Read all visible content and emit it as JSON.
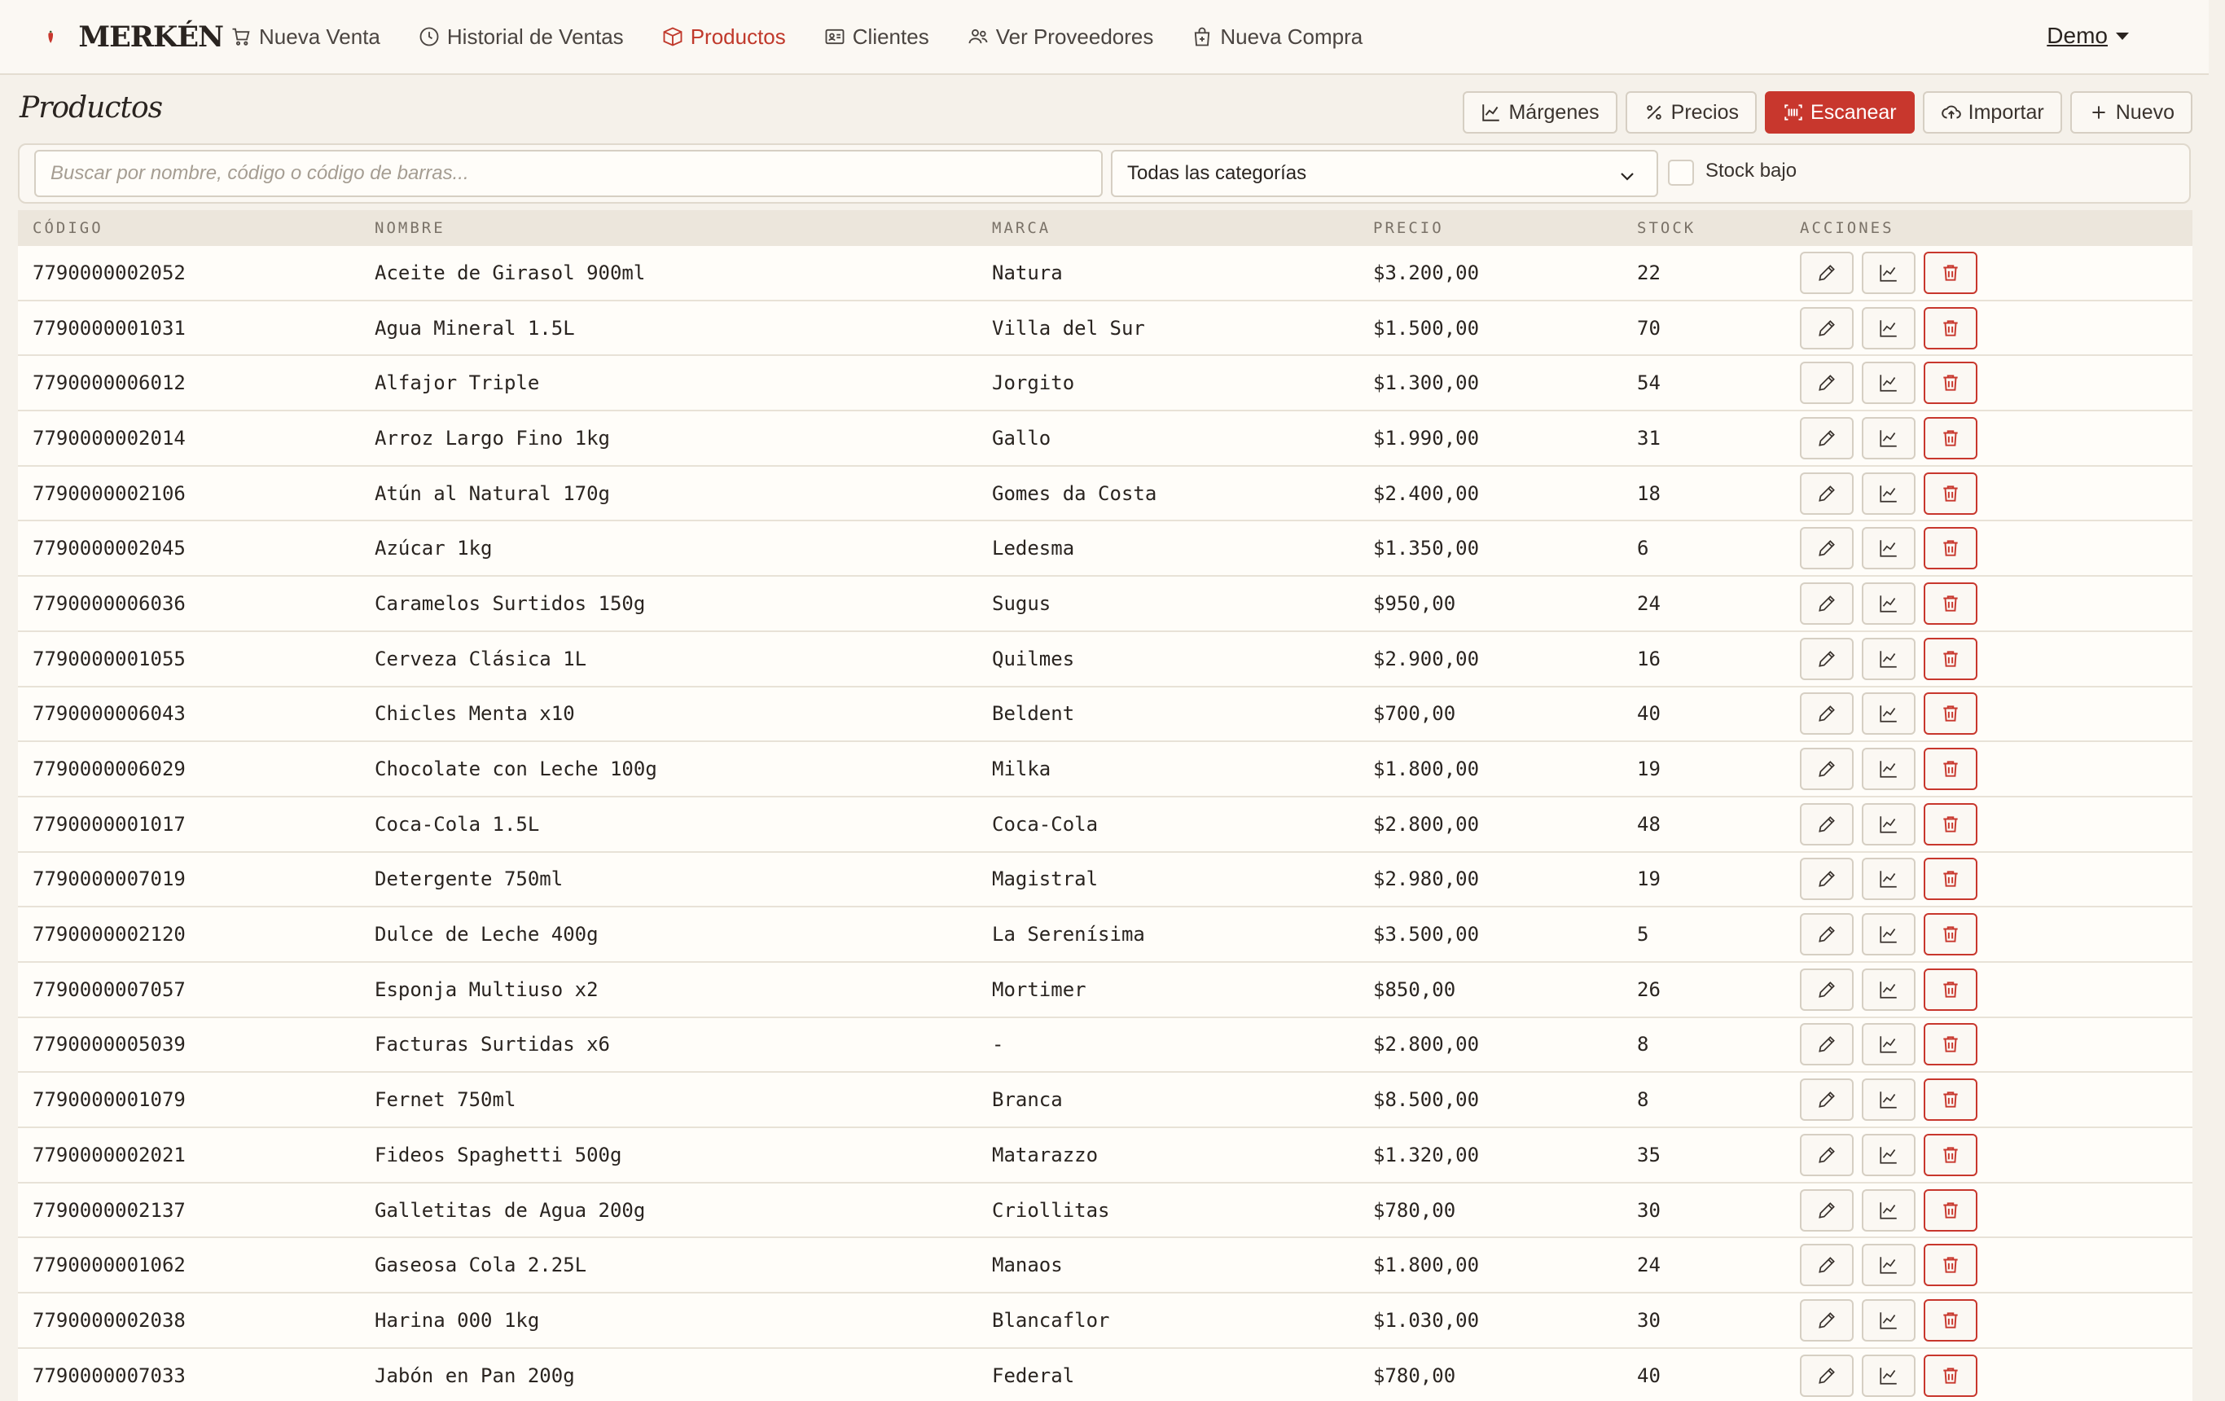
{
  "brand": {
    "name": "MERKÉN"
  },
  "nav": [
    {
      "key": "nueva-venta",
      "label": "Nueva Venta",
      "icon": "cart-icon",
      "active": false
    },
    {
      "key": "historial",
      "label": "Historial de Ventas",
      "icon": "clock-icon",
      "active": false
    },
    {
      "key": "productos",
      "label": "Productos",
      "icon": "box-icon",
      "active": true
    },
    {
      "key": "clientes",
      "label": "Clientes",
      "icon": "id-card-icon",
      "active": false
    },
    {
      "key": "proveedores",
      "label": "Ver Proveedores",
      "icon": "users-icon",
      "active": false
    },
    {
      "key": "nueva-compra",
      "label": "Nueva Compra",
      "icon": "bag-plus-icon",
      "active": false
    }
  ],
  "user": {
    "name": "Demo"
  },
  "page": {
    "title": "Productos"
  },
  "toolbar": {
    "margenes": "Márgenes",
    "precios": "Precios",
    "escanear": "Escanear",
    "importar": "Importar",
    "nuevo": "Nuevo"
  },
  "filters": {
    "search_placeholder": "Buscar por nombre, código o código de barras...",
    "category_selected": "Todas las categorías",
    "stock_low_label": "Stock bajo"
  },
  "table": {
    "headers": [
      "CÓDIGO",
      "NOMBRE",
      "MARCA",
      "PRECIO",
      "STOCK",
      "ACCIONES"
    ],
    "rows": [
      [
        "7790000002052",
        "Aceite de Girasol 900ml",
        "Natura",
        "$3.200,00",
        "22"
      ],
      [
        "7790000001031",
        "Agua Mineral 1.5L",
        "Villa del Sur",
        "$1.500,00",
        "70"
      ],
      [
        "7790000006012",
        "Alfajor Triple",
        "Jorgito",
        "$1.300,00",
        "54"
      ],
      [
        "7790000002014",
        "Arroz Largo Fino 1kg",
        "Gallo",
        "$1.990,00",
        "31"
      ],
      [
        "7790000002106",
        "Atún al Natural 170g",
        "Gomes da Costa",
        "$2.400,00",
        "18"
      ],
      [
        "7790000002045",
        "Azúcar 1kg",
        "Ledesma",
        "$1.350,00",
        "6"
      ],
      [
        "7790000006036",
        "Caramelos Surtidos 150g",
        "Sugus",
        "$950,00",
        "24"
      ],
      [
        "7790000001055",
        "Cerveza Clásica 1L",
        "Quilmes",
        "$2.900,00",
        "16"
      ],
      [
        "7790000006043",
        "Chicles Menta x10",
        "Beldent",
        "$700,00",
        "40"
      ],
      [
        "7790000006029",
        "Chocolate con Leche 100g",
        "Milka",
        "$1.800,00",
        "19"
      ],
      [
        "7790000001017",
        "Coca-Cola 1.5L",
        "Coca-Cola",
        "$2.800,00",
        "48"
      ],
      [
        "7790000007019",
        "Detergente 750ml",
        "Magistral",
        "$2.980,00",
        "19"
      ],
      [
        "7790000002120",
        "Dulce de Leche 400g",
        "La Serenísima",
        "$3.500,00",
        "5"
      ],
      [
        "7790000007057",
        "Esponja Multiuso x2",
        "Mortimer",
        "$850,00",
        "26"
      ],
      [
        "7790000005039",
        "Facturas Surtidas x6",
        "-",
        "$2.800,00",
        "8"
      ],
      [
        "7790000001079",
        "Fernet 750ml",
        "Branca",
        "$8.500,00",
        "8"
      ],
      [
        "7790000002021",
        "Fideos Spaghetti 500g",
        "Matarazzo",
        "$1.320,00",
        "35"
      ],
      [
        "7790000002137",
        "Galletitas de Agua 200g",
        "Criollitas",
        "$780,00",
        "30"
      ],
      [
        "7790000001062",
        "Gaseosa Cola 2.25L",
        "Manaos",
        "$1.800,00",
        "24"
      ],
      [
        "7790000002038",
        "Harina 000 1kg",
        "Blancaflor",
        "$1.030,00",
        "30"
      ],
      [
        "7790000007033",
        "Jabón en Pan 200g",
        "Federal",
        "$780,00",
        "40"
      ]
    ]
  },
  "colors": {
    "accent": "#c8372d",
    "background": "#f5f1ea"
  }
}
